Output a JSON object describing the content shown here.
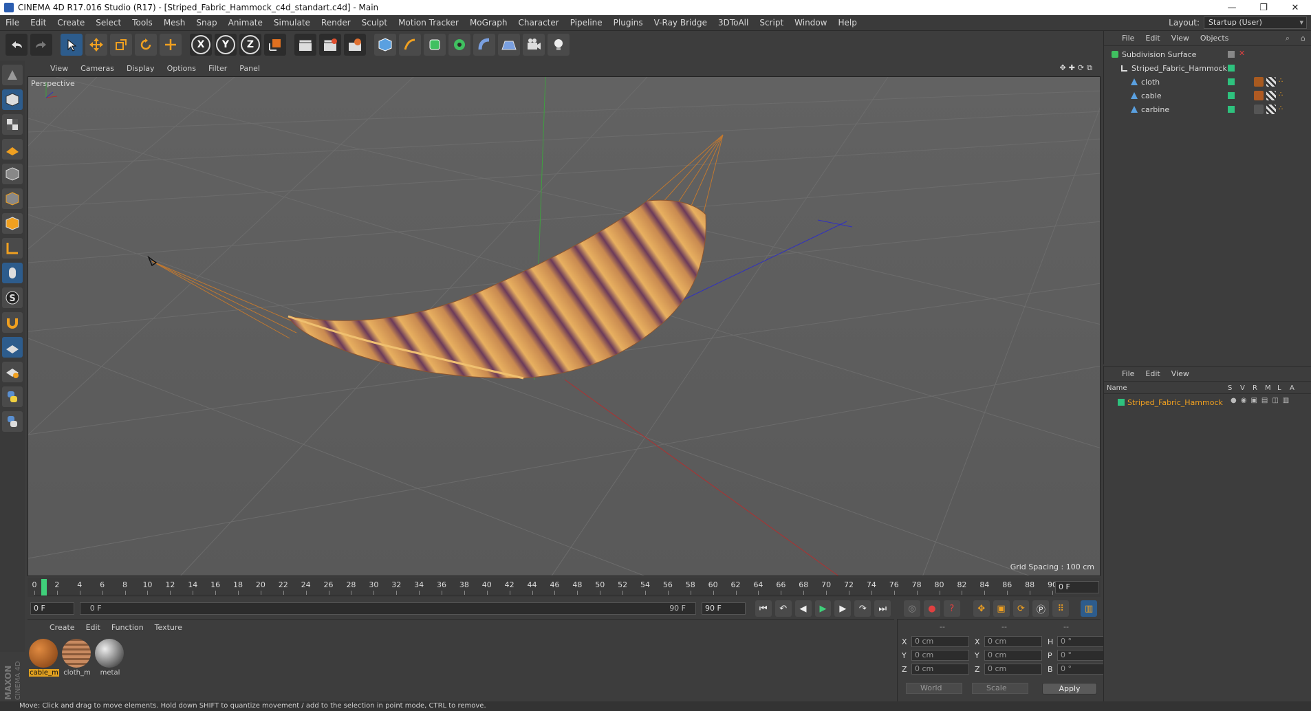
{
  "window": {
    "title": "CINEMA 4D R17.016 Studio (R17) - [Striped_Fabric_Hammock_c4d_standart.c4d] - Main",
    "minimize": "—",
    "restore": "❐",
    "close": "✕"
  },
  "menubar": {
    "items": [
      "File",
      "Edit",
      "Create",
      "Select",
      "Tools",
      "Mesh",
      "Snap",
      "Animate",
      "Simulate",
      "Render",
      "Sculpt",
      "Motion Tracker",
      "MoGraph",
      "Character",
      "Pipeline",
      "Plugins",
      "V-Ray Bridge",
      "3DToAll",
      "Script",
      "Window",
      "Help"
    ],
    "layout_label": "Layout:",
    "layout_value": "Startup (User)"
  },
  "toolbar": {
    "axes": [
      "X",
      "Y",
      "Z"
    ]
  },
  "viewport": {
    "menu": [
      "View",
      "Cameras",
      "Display",
      "Options",
      "Filter",
      "Panel"
    ],
    "label": "Perspective",
    "grid_spacing": "Grid Spacing : 100 cm",
    "nav_icons": "✥✚⟳⧉"
  },
  "timeline": {
    "ticks": [
      "0",
      "2",
      "4",
      "6",
      "8",
      "10",
      "12",
      "14",
      "16",
      "18",
      "20",
      "22",
      "24",
      "26",
      "28",
      "30",
      "32",
      "34",
      "36",
      "38",
      "40",
      "42",
      "44",
      "46",
      "48",
      "50",
      "52",
      "54",
      "56",
      "58",
      "60",
      "62",
      "64",
      "66",
      "68",
      "70",
      "72",
      "74",
      "76",
      "78",
      "80",
      "82",
      "84",
      "86",
      "88",
      "90"
    ],
    "current_frame": "0 F"
  },
  "transport": {
    "start_field": "0 F",
    "range_start": "0 F",
    "range_end": "90 F",
    "end_field": "90 F"
  },
  "material_manager": {
    "menu": [
      "Create",
      "Edit",
      "Function",
      "Texture"
    ],
    "materials": [
      {
        "name": "cable_m",
        "color": "#b05a22"
      },
      {
        "name": "cloth_m",
        "color": "#a8704a"
      },
      {
        "name": "metal",
        "color": "#8a8a8a"
      }
    ]
  },
  "coordinates": {
    "header": [
      "--",
      "--",
      "--"
    ],
    "rows": [
      {
        "a": "X",
        "av": "0 cm",
        "b": "X",
        "bv": "0 cm",
        "c": "H",
        "cv": "0 °"
      },
      {
        "a": "Y",
        "av": "0 cm",
        "b": "Y",
        "bv": "0 cm",
        "c": "P",
        "cv": "0 °"
      },
      {
        "a": "Z",
        "av": "0 cm",
        "b": "Z",
        "bv": "0 cm",
        "c": "B",
        "cv": "0 °"
      }
    ],
    "world": "World",
    "scale": "Scale",
    "apply": "Apply"
  },
  "status": {
    "text": "Move: Click and drag to move elements. Hold down SHIFT to quantize movement / add to the selection in point mode, CTRL to remove."
  },
  "object_manager": {
    "menu": [
      "File",
      "Edit",
      "View",
      "Objects"
    ],
    "objects": [
      {
        "name": "Subdivision Surface",
        "level": 0
      },
      {
        "name": "Striped_Fabric_Hammock",
        "level": 1
      },
      {
        "name": "cloth",
        "level": 2
      },
      {
        "name": "cable",
        "level": 2
      },
      {
        "name": "carbine",
        "level": 2
      }
    ]
  },
  "attribute_manager": {
    "menu": [
      "File",
      "Edit",
      "View"
    ],
    "columns": [
      "Name",
      "S",
      "V",
      "R",
      "M",
      "L",
      "A"
    ],
    "layer_name": "Striped_Fabric_Hammock"
  },
  "logo": {
    "text": "MAXON CINEMA 4D"
  },
  "colors": {
    "accent": "#2ec27e",
    "selection": "#e0a020",
    "hammock_light": "#e8b060",
    "hammock_dark": "#6b3a5a"
  }
}
